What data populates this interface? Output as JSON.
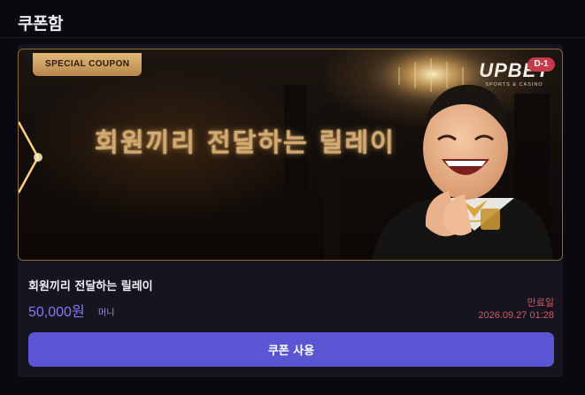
{
  "header": {
    "title": "쿠폰함"
  },
  "coupon": {
    "banner": {
      "badge": "SPECIAL COUPON",
      "heading": "회원끼리 전달하는 릴레이",
      "logo_text": "UPBET",
      "logo_sub": "SPORTS & CASINO",
      "dday": "D-1"
    },
    "name": "회원끼리 전달하는 릴레이",
    "amount": "50,000원",
    "amount_unit": "머니",
    "expire_label": "만료일",
    "expire_date": "2026.09.27 01:28",
    "use_button": "쿠폰 사용"
  },
  "colors": {
    "accent": "#5a55d2",
    "amount": "#7e7bf3",
    "expire": "#d9576a",
    "gold": "#d2a96e"
  }
}
